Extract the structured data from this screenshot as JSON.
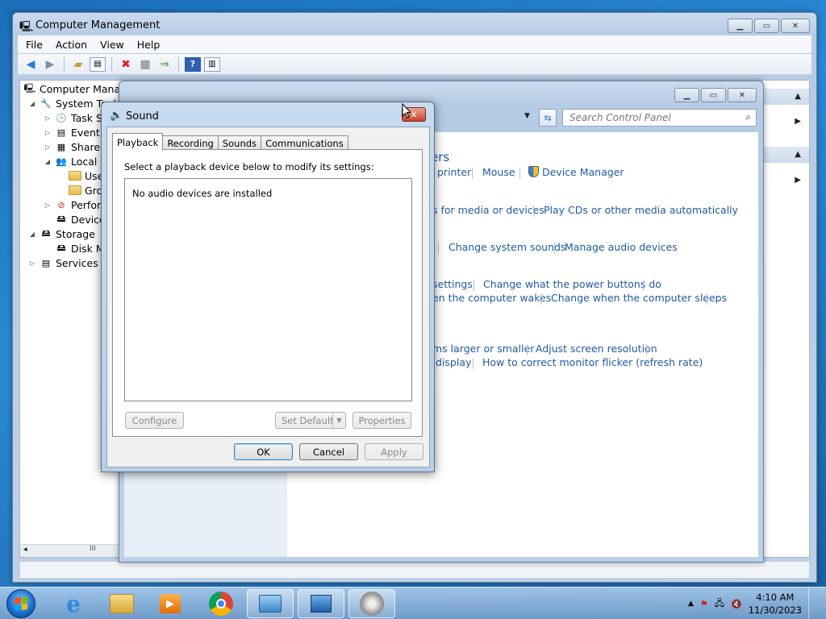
{
  "computer_management": {
    "title": "Computer Management",
    "menu": [
      "File",
      "Action",
      "View",
      "Help"
    ],
    "tree": [
      {
        "label": "Computer Manage",
        "level": 0,
        "toggle": ""
      },
      {
        "label": "System Tool",
        "level": 1,
        "toggle": "◢"
      },
      {
        "label": "Task Sc",
        "level": 2,
        "toggle": "▷"
      },
      {
        "label": "Event V",
        "level": 2,
        "toggle": "▷"
      },
      {
        "label": "Shared",
        "level": 2,
        "toggle": "▷"
      },
      {
        "label": "Local U",
        "level": 2,
        "toggle": "◢"
      },
      {
        "label": "Use",
        "level": 3,
        "toggle": ""
      },
      {
        "label": "Gro",
        "level": 3,
        "toggle": ""
      },
      {
        "label": "Perforn",
        "level": 2,
        "toggle": "▷"
      },
      {
        "label": "Device",
        "level": 2,
        "toggle": ""
      },
      {
        "label": "Storage",
        "level": 1,
        "toggle": "◢"
      },
      {
        "label": "Disk M",
        "level": 2,
        "toggle": ""
      },
      {
        "label": "Services an",
        "level": 1,
        "toggle": "▷"
      }
    ],
    "scroll_thumb": "III"
  },
  "control_panel": {
    "search_placeholder": "Search Control Panel",
    "heading": "ers",
    "links": {
      "printer": "printer",
      "mouse": "Mouse",
      "device_manager": "Device Manager",
      "autoplay_defaults": "s for media or devices",
      "play_cds": "Play CDs or other media automatically",
      "change_sounds": "Change system sounds",
      "manage_audio": "Manage audio devices",
      "power_settings": "settings",
      "power_buttons": "Change what the power buttons do",
      "wakes": "en the computer wakes",
      "sleeps": "Change when the computer sleeps",
      "text_larger": "ms larger or smaller",
      "resolution": "Adjust screen resolution",
      "display": "display",
      "flicker": "How to correct monitor flicker (refresh rate)"
    }
  },
  "sound_dialog": {
    "title": "Sound",
    "tabs": [
      "Playback",
      "Recording",
      "Sounds",
      "Communications"
    ],
    "active_tab": "Playback",
    "instruction": "Select a playback device below to modify its settings:",
    "empty_message": "No audio devices are installed",
    "buttons": {
      "configure": "Configure",
      "set_default": "Set Default",
      "properties": "Properties",
      "ok": "OK",
      "cancel": "Cancel",
      "apply": "Apply"
    }
  },
  "taskbar": {
    "time": "4:10 AM",
    "date": "11/30/2023"
  }
}
